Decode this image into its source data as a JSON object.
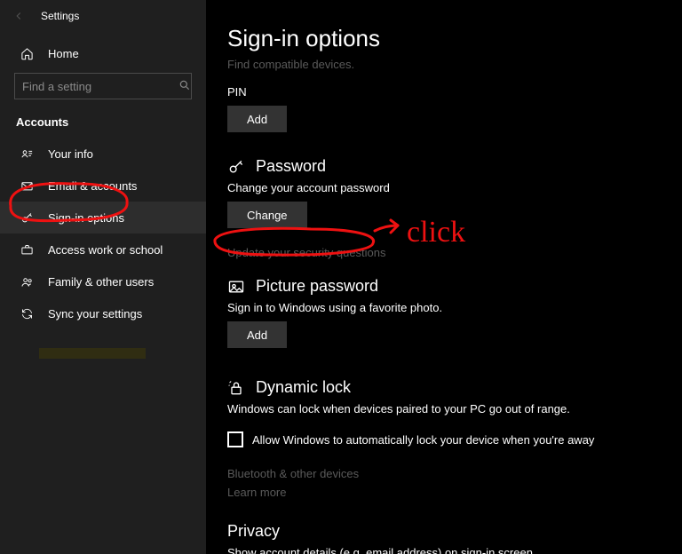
{
  "window": {
    "title": "Settings"
  },
  "sidebar": {
    "home": "Home",
    "search_placeholder": "Find a setting",
    "category": "Accounts",
    "items": [
      {
        "label": "Your info"
      },
      {
        "label": "Email & accounts"
      },
      {
        "label": "Sign-in options"
      },
      {
        "label": "Access work or school"
      },
      {
        "label": "Family & other users"
      },
      {
        "label": "Sync your settings"
      }
    ]
  },
  "page": {
    "title": "Sign-in options",
    "subtitle": "Find compatible devices.",
    "pin": {
      "label": "PIN",
      "button": "Add"
    },
    "password": {
      "heading": "Password",
      "desc": "Change your account password",
      "button": "Change",
      "update_link": "Update your security questions"
    },
    "picture": {
      "heading": "Picture password",
      "desc": "Sign in to Windows using a favorite photo.",
      "button": "Add"
    },
    "dynamic": {
      "heading": "Dynamic lock",
      "desc": "Windows can lock when devices paired to your PC go out of range.",
      "checkbox": "Allow Windows to automatically lock your device when you're away",
      "bt_link": "Bluetooth & other devices",
      "learn_link": "Learn more"
    },
    "privacy": {
      "heading": "Privacy",
      "desc": "Show account details (e.g. email address) on sign-in screen"
    }
  },
  "annotation": {
    "text": "click"
  }
}
